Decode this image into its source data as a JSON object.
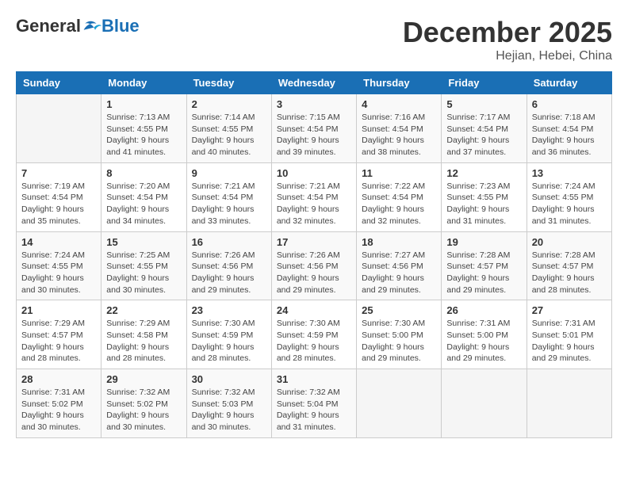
{
  "header": {
    "logo_general": "General",
    "logo_blue": "Blue",
    "month_title": "December 2025",
    "location": "Hejian, Hebei, China"
  },
  "weekdays": [
    "Sunday",
    "Monday",
    "Tuesday",
    "Wednesday",
    "Thursday",
    "Friday",
    "Saturday"
  ],
  "weeks": [
    [
      {
        "day": "",
        "info": ""
      },
      {
        "day": "1",
        "info": "Sunrise: 7:13 AM\nSunset: 4:55 PM\nDaylight: 9 hours\nand 41 minutes."
      },
      {
        "day": "2",
        "info": "Sunrise: 7:14 AM\nSunset: 4:55 PM\nDaylight: 9 hours\nand 40 minutes."
      },
      {
        "day": "3",
        "info": "Sunrise: 7:15 AM\nSunset: 4:54 PM\nDaylight: 9 hours\nand 39 minutes."
      },
      {
        "day": "4",
        "info": "Sunrise: 7:16 AM\nSunset: 4:54 PM\nDaylight: 9 hours\nand 38 minutes."
      },
      {
        "day": "5",
        "info": "Sunrise: 7:17 AM\nSunset: 4:54 PM\nDaylight: 9 hours\nand 37 minutes."
      },
      {
        "day": "6",
        "info": "Sunrise: 7:18 AM\nSunset: 4:54 PM\nDaylight: 9 hours\nand 36 minutes."
      }
    ],
    [
      {
        "day": "7",
        "info": "Sunrise: 7:19 AM\nSunset: 4:54 PM\nDaylight: 9 hours\nand 35 minutes."
      },
      {
        "day": "8",
        "info": "Sunrise: 7:20 AM\nSunset: 4:54 PM\nDaylight: 9 hours\nand 34 minutes."
      },
      {
        "day": "9",
        "info": "Sunrise: 7:21 AM\nSunset: 4:54 PM\nDaylight: 9 hours\nand 33 minutes."
      },
      {
        "day": "10",
        "info": "Sunrise: 7:21 AM\nSunset: 4:54 PM\nDaylight: 9 hours\nand 32 minutes."
      },
      {
        "day": "11",
        "info": "Sunrise: 7:22 AM\nSunset: 4:54 PM\nDaylight: 9 hours\nand 32 minutes."
      },
      {
        "day": "12",
        "info": "Sunrise: 7:23 AM\nSunset: 4:55 PM\nDaylight: 9 hours\nand 31 minutes."
      },
      {
        "day": "13",
        "info": "Sunrise: 7:24 AM\nSunset: 4:55 PM\nDaylight: 9 hours\nand 31 minutes."
      }
    ],
    [
      {
        "day": "14",
        "info": "Sunrise: 7:24 AM\nSunset: 4:55 PM\nDaylight: 9 hours\nand 30 minutes."
      },
      {
        "day": "15",
        "info": "Sunrise: 7:25 AM\nSunset: 4:55 PM\nDaylight: 9 hours\nand 30 minutes."
      },
      {
        "day": "16",
        "info": "Sunrise: 7:26 AM\nSunset: 4:56 PM\nDaylight: 9 hours\nand 29 minutes."
      },
      {
        "day": "17",
        "info": "Sunrise: 7:26 AM\nSunset: 4:56 PM\nDaylight: 9 hours\nand 29 minutes."
      },
      {
        "day": "18",
        "info": "Sunrise: 7:27 AM\nSunset: 4:56 PM\nDaylight: 9 hours\nand 29 minutes."
      },
      {
        "day": "19",
        "info": "Sunrise: 7:28 AM\nSunset: 4:57 PM\nDaylight: 9 hours\nand 29 minutes."
      },
      {
        "day": "20",
        "info": "Sunrise: 7:28 AM\nSunset: 4:57 PM\nDaylight: 9 hours\nand 28 minutes."
      }
    ],
    [
      {
        "day": "21",
        "info": "Sunrise: 7:29 AM\nSunset: 4:57 PM\nDaylight: 9 hours\nand 28 minutes."
      },
      {
        "day": "22",
        "info": "Sunrise: 7:29 AM\nSunset: 4:58 PM\nDaylight: 9 hours\nand 28 minutes."
      },
      {
        "day": "23",
        "info": "Sunrise: 7:30 AM\nSunset: 4:59 PM\nDaylight: 9 hours\nand 28 minutes."
      },
      {
        "day": "24",
        "info": "Sunrise: 7:30 AM\nSunset: 4:59 PM\nDaylight: 9 hours\nand 28 minutes."
      },
      {
        "day": "25",
        "info": "Sunrise: 7:30 AM\nSunset: 5:00 PM\nDaylight: 9 hours\nand 29 minutes."
      },
      {
        "day": "26",
        "info": "Sunrise: 7:31 AM\nSunset: 5:00 PM\nDaylight: 9 hours\nand 29 minutes."
      },
      {
        "day": "27",
        "info": "Sunrise: 7:31 AM\nSunset: 5:01 PM\nDaylight: 9 hours\nand 29 minutes."
      }
    ],
    [
      {
        "day": "28",
        "info": "Sunrise: 7:31 AM\nSunset: 5:02 PM\nDaylight: 9 hours\nand 30 minutes."
      },
      {
        "day": "29",
        "info": "Sunrise: 7:32 AM\nSunset: 5:02 PM\nDaylight: 9 hours\nand 30 minutes."
      },
      {
        "day": "30",
        "info": "Sunrise: 7:32 AM\nSunset: 5:03 PM\nDaylight: 9 hours\nand 30 minutes."
      },
      {
        "day": "31",
        "info": "Sunrise: 7:32 AM\nSunset: 5:04 PM\nDaylight: 9 hours\nand 31 minutes."
      },
      {
        "day": "",
        "info": ""
      },
      {
        "day": "",
        "info": ""
      },
      {
        "day": "",
        "info": ""
      }
    ]
  ]
}
